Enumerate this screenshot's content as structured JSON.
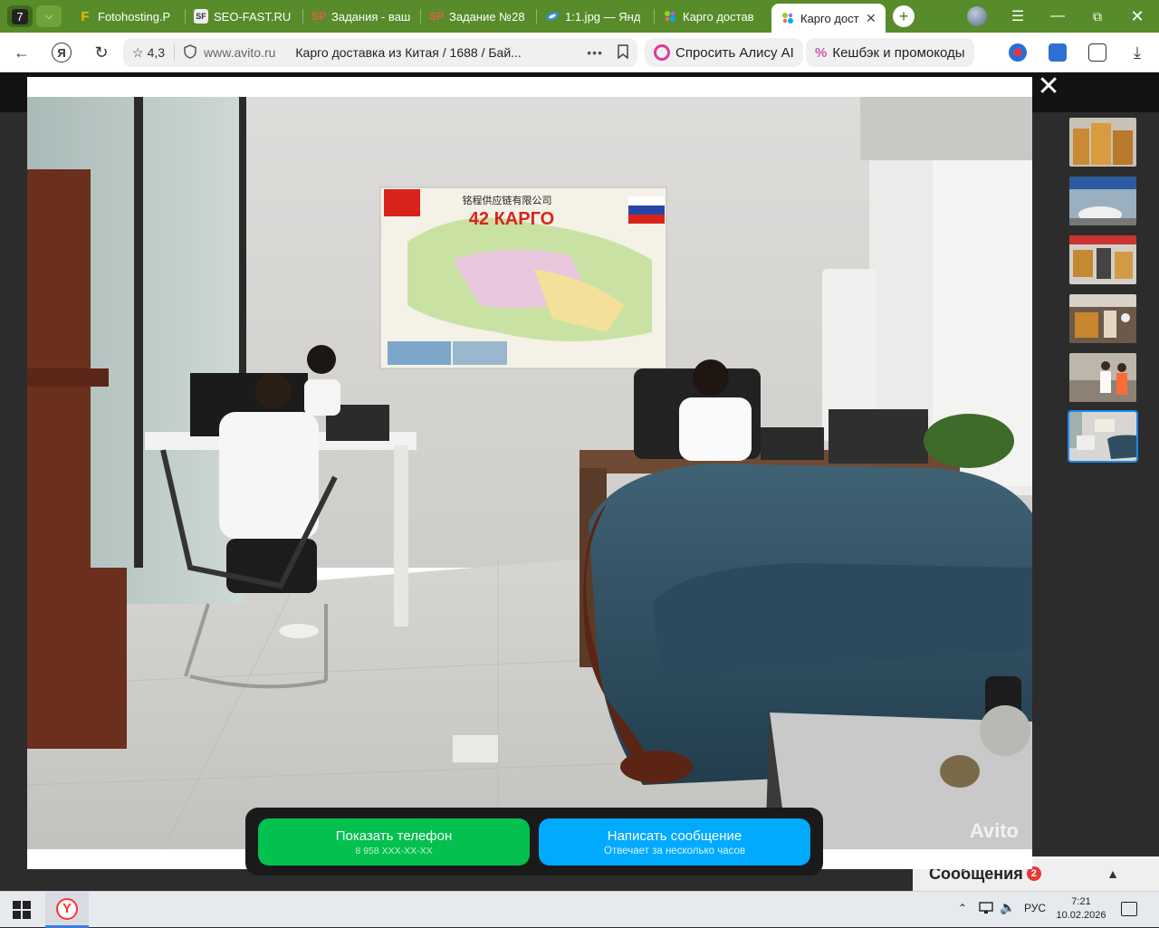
{
  "browser": {
    "tab_count": "7",
    "tabs": [
      {
        "title": "Fotohosting.P",
        "favicon": "F",
        "color": "#f5b800"
      },
      {
        "title": "SEO-FAST.RU",
        "favicon": "SF",
        "color": "#ffffff"
      },
      {
        "title": "Задания - ваш",
        "favicon": "SP",
        "color": "#c0392b"
      },
      {
        "title": "Задание №28",
        "favicon": "SP",
        "color": "#c0392b"
      },
      {
        "title": "1:1.jpg — Янд",
        "favicon": "disk",
        "color": "#3b8ef0"
      },
      {
        "title": "Карго достав",
        "favicon": "avito",
        "color": "#97cf26"
      },
      {
        "title": "Карго дост",
        "favicon": "avito",
        "color": "#97cf26",
        "active": true
      }
    ],
    "address": {
      "rating": "4,3",
      "domain": "www.avito.ru",
      "page_title": "Карго доставка из Китая / 1688 / Бай..."
    },
    "alice_label": "Спросить Алису AI",
    "cashback_label": "Кешбэк и промокоды"
  },
  "gallery": {
    "thumbnails": [
      "thumb-1",
      "thumb-2",
      "thumb-3",
      "thumb-4",
      "thumb-5",
      "thumb-6"
    ],
    "active_thumbnail": 6,
    "photo": {
      "map_title_cn": "铭程供应链有限公司",
      "map_title": "42 КАРГО",
      "watermark": "Avito"
    }
  },
  "cta": {
    "phone_label": "Показать телефон",
    "phone_number": "8 958 XXX-XX-XX",
    "message_label": "Написать сообщение",
    "message_sub": "Отвечает за несколько часов"
  },
  "messages_panel": {
    "label": "Сообщения",
    "badge": "2"
  },
  "taskbar": {
    "language": "РУС",
    "time": "7:21",
    "date": "10.02.2026"
  }
}
